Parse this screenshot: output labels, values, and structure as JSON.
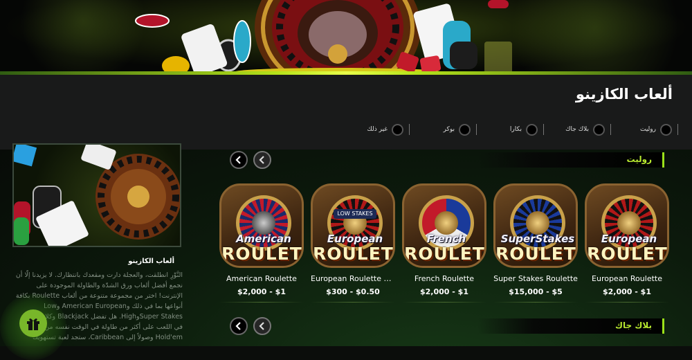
{
  "header": {
    "title": "ألعاب الكازينو",
    "filters": [
      {
        "label": "روليت",
        "icon": "radio-icon"
      },
      {
        "label": "بلاك جاك",
        "icon": "radio-icon"
      },
      {
        "label": "بكارا",
        "icon": "radio-icon"
      },
      {
        "label": "بوكر",
        "icon": "radio-icon"
      },
      {
        "label": "غير ذلك",
        "icon": "radio-icon"
      }
    ]
  },
  "promo": {
    "title": "ألعاب الكازينو",
    "lines": [
      "النَّوْرِ انطلقت، والعجلة دارت ومقعدك بانتظارك. لا يزيدنا إلّا أن",
      "نجمع أفضل ألعاب ورق الشدّة والطاولة الموجودة على",
      "الإنترنت! اختر من مجموعة متنوعة من ألعاب Roulette بكافة",
      "أنواعها بما في ذلك وAmerican European وLow",
      "Super StakesوHigh. هل تفضل Blackjack وكلاسيك",
      "في اللعب على أكثر من طاولة في الوقت نفسه من",
      "Hold'em وصولاً إلى Caribbean، ستجد لعبة تستهويك"
    ]
  },
  "sections": [
    {
      "title": "روليت"
    },
    {
      "title": "بلاك جاك"
    }
  ],
  "games": [
    {
      "name": "European Roulette",
      "limits": "$2,000 - $1",
      "logo_top": "European",
      "logo_bottom": "ROULETTE",
      "tag": ""
    },
    {
      "name": "Super Stakes Roulette",
      "limits": "$15,000 - $5",
      "logo_top": "SuperStakes",
      "logo_bottom": "ROULETTE",
      "tag": ""
    },
    {
      "name": "French Roulette",
      "limits": "$2,000 - $1",
      "logo_top": "French",
      "logo_bottom": "ROULETTE",
      "tag": ""
    },
    {
      "name": "European Roulette Low ...",
      "limits": "$300 - $0.50",
      "logo_top": "European",
      "logo_bottom": "ROULETTE",
      "tag": "LOW STAKES"
    },
    {
      "name": "American Roulette",
      "limits": "$2,000 - $1",
      "logo_top": "American",
      "logo_bottom": "ROULETTE",
      "tag": ""
    }
  ],
  "colors": {
    "accent": "#9be21a",
    "background": "#0b0d0b",
    "header_strip": "#191a1a",
    "gift": "#78b62a"
  },
  "icons": {
    "prev": "chevron-left-icon",
    "next": "chevron-right-icon",
    "gift": "gift-icon"
  }
}
